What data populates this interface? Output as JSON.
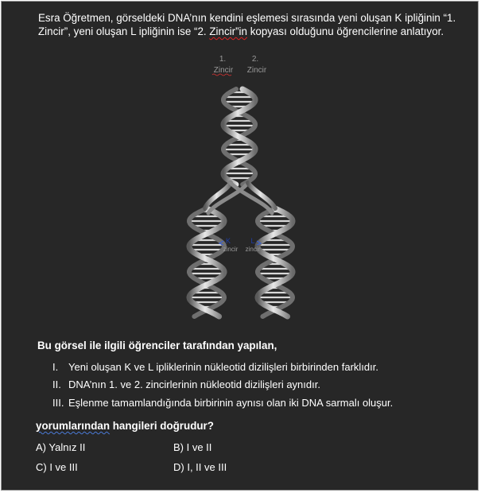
{
  "question": {
    "line1": "Esra Öğretmen, görseldeki DNA’nın kendini eşlemesi sırasında yeni oluşan K ipliğinin “1.",
    "line2_before": "Zincir”, yeni oluşan L ipliğinin ise “2. ",
    "line2_marked": "Zincir”in",
    "line2_after": " kopyası olduğunu öğrencilerine anlatıyor."
  },
  "figure": {
    "label_1_num": "1.",
    "label_1_word": "Zincir",
    "label_2_num": "2.",
    "label_2_word": "Zincir",
    "label_k": "K",
    "label_k_word": "zincir",
    "label_l": "L",
    "label_l_word": "zincir"
  },
  "subtitle": "Bu görsel ile ilgili öğrenciler tarafından yapılan,",
  "statements": [
    {
      "num": "I.",
      "text": "Yeni oluşan K ve L ipliklerinin nükleotid dizilişleri birbirinden farklıdır."
    },
    {
      "num": "II.",
      "text": "DNA’nın 1. ve 2. zincirlerinin nükleotid dizilişleri aynıdır."
    },
    {
      "num": "III.",
      "text": "Eşlenme tamamlandığında birbirinin aynısı olan iki DNA sarmalı oluşur."
    }
  ],
  "question_end": {
    "marked": "yorumlarından",
    "rest": " hangileri doğrudur?"
  },
  "options": {
    "a": "A) Yalnız II",
    "b": "B) I ve II",
    "c": "C) I ve III",
    "d": "D) I, II ve III"
  }
}
